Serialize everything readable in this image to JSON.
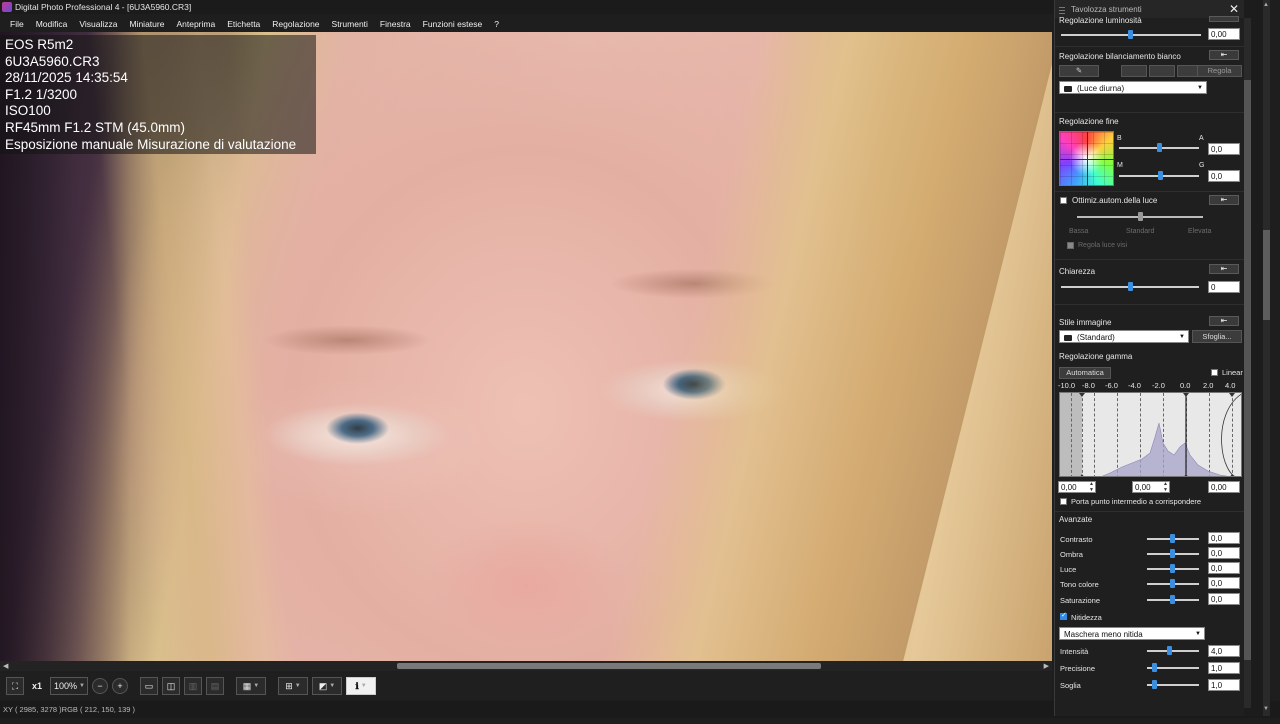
{
  "window": {
    "title": "Digital Photo Professional 4 - [6U3A5960.CR3]"
  },
  "menu": [
    "File",
    "Modifica",
    "Visualizza",
    "Miniature",
    "Anteprima",
    "Etichetta",
    "Regolazione",
    "Strumenti",
    "Finestra",
    "Funzioni estese",
    "?"
  ],
  "photo_info": [
    "EOS R5m2",
    "6U3A5960.CR3",
    "28/11/2025 14:35:54",
    "F1.2 1/3200",
    "ISO100",
    "RF45mm F1.2 STM (45.0mm)",
    "Esposizione manuale Misurazione di valutazione"
  ],
  "toolbar": {
    "zoom_1x": "x1",
    "zoom_value": "100%"
  },
  "status": {
    "coords": "XY ( 2985, 3278 )RGB ( 212, 150, 139 )",
    "gb": "GB"
  },
  "palette": {
    "title": "Tavolozza strumenti",
    "brightness": {
      "label": "Regolazione luminosità",
      "value": "0,00"
    },
    "white_balance": {
      "label": "Regolazione bilanciamento bianco",
      "adjust_button": "Regola",
      "preset": "(Luce diurna)"
    },
    "fine": {
      "label": "Regolazione fine",
      "b": "B",
      "a": "A",
      "m": "M",
      "g": "G",
      "ba_value": "0,0",
      "mg_value": "0,0"
    },
    "alo": {
      "label": "Ottimiz.autom.della luce",
      "low": "Bassa",
      "standard": "Standard",
      "high": "Elevata",
      "faces": "Regola luce visi"
    },
    "clarity": {
      "label": "Chiarezza",
      "value": "0"
    },
    "picture_style": {
      "label": "Stile immagine",
      "value": "(Standard)",
      "browse": "Sfoglia..."
    },
    "gamma": {
      "label": "Regolazione gamma",
      "auto": "Automatica",
      "linear": "Linear",
      "scale": [
        "-10.0",
        "-8.0",
        "-6.0",
        "-4.0",
        "-2.0",
        "0.0",
        "2.0",
        "4.0"
      ],
      "left_value": "0,00",
      "mid_value": "0,00",
      "right_value": "0,00",
      "midpoint_label": "Porta punto intermedio a corrispondere"
    },
    "advanced": {
      "label": "Avanzate",
      "rows": [
        {
          "label": "Contrasto",
          "value": "0,0"
        },
        {
          "label": "Ombra",
          "value": "0,0"
        },
        {
          "label": "Luce",
          "value": "0,0"
        },
        {
          "label": "Tono colore",
          "value": "0,0"
        },
        {
          "label": "Saturazione",
          "value": "0,0"
        }
      ]
    },
    "sharpness": {
      "label": "Nitidezza",
      "mode": "Maschera meno nitida",
      "rows": [
        {
          "label": "Intensità",
          "value": "4,0"
        },
        {
          "label": "Precisione",
          "value": "1,0"
        },
        {
          "label": "Soglia",
          "value": "1,0"
        }
      ]
    }
  }
}
